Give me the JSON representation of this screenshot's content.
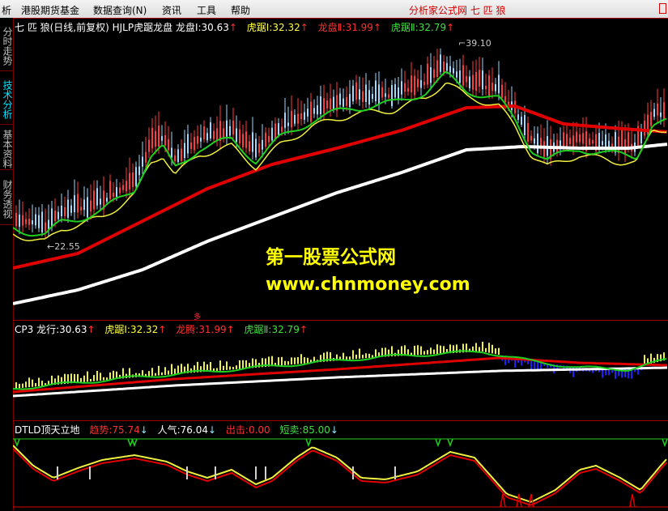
{
  "menubar": {
    "items": [
      "析",
      "港股期货基金",
      "数据查询(N)",
      "资讯",
      "工具",
      "帮助"
    ],
    "brand": "分析家公式网 七 匹 狼"
  },
  "side_tabs": [
    "分时走势",
    "技术分析",
    "基本资料",
    "财务透视"
  ],
  "main_chart": {
    "legend": {
      "prefix": "七 匹 狼(日线,前复权) HJLP虎踞龙盘",
      "l1_label": "龙盘Ⅰ:",
      "l1_value": "30.63",
      "l2_label": "虎踞Ⅰ:",
      "l2_value": "32.32",
      "l3_label": "龙盘Ⅱ:",
      "l3_value": "31.99",
      "l4_label": "虎踞Ⅱ:",
      "l4_value": "32.79",
      "up_arrow": "↑"
    },
    "high_label": "39.10",
    "low_label": "22.55",
    "watermark_title": "第一股票公式网",
    "watermark_url": "www.chnmoney.com"
  },
  "sub_chart": {
    "legend": {
      "prefix": "CP3",
      "l1_label": "龙行:",
      "l1_value": "30.63",
      "l2_label": "虎踞Ⅰ:",
      "l2_value": "32.32",
      "l3_label": "龙腾:",
      "l3_value": "31.99",
      "l4_label": "虎踞Ⅱ:",
      "l4_value": "32.79",
      "up_arrow": "↑"
    },
    "marker": "多"
  },
  "oscillator": {
    "legend": {
      "prefix": "DTLD顶天立地",
      "l1_label": "趋势:",
      "l1_value": "75.74",
      "l2_label": "人气:",
      "l2_value": "76.04",
      "l3_label": "出击:",
      "l3_value": "0.00",
      "l4_label": "短卖:",
      "l4_value": "85.00",
      "down_arrow": "↓"
    }
  },
  "colors": {
    "background": "#000000",
    "grid_border": "#a00000",
    "white_line": "#ffffff",
    "red_line": "#e00000",
    "green_line": "#20d020",
    "yellow_line": "#f0f040",
    "candle_up": "#ff3c3c",
    "candle_down": "#9bd8ff",
    "blue": "#2020ff"
  }
}
